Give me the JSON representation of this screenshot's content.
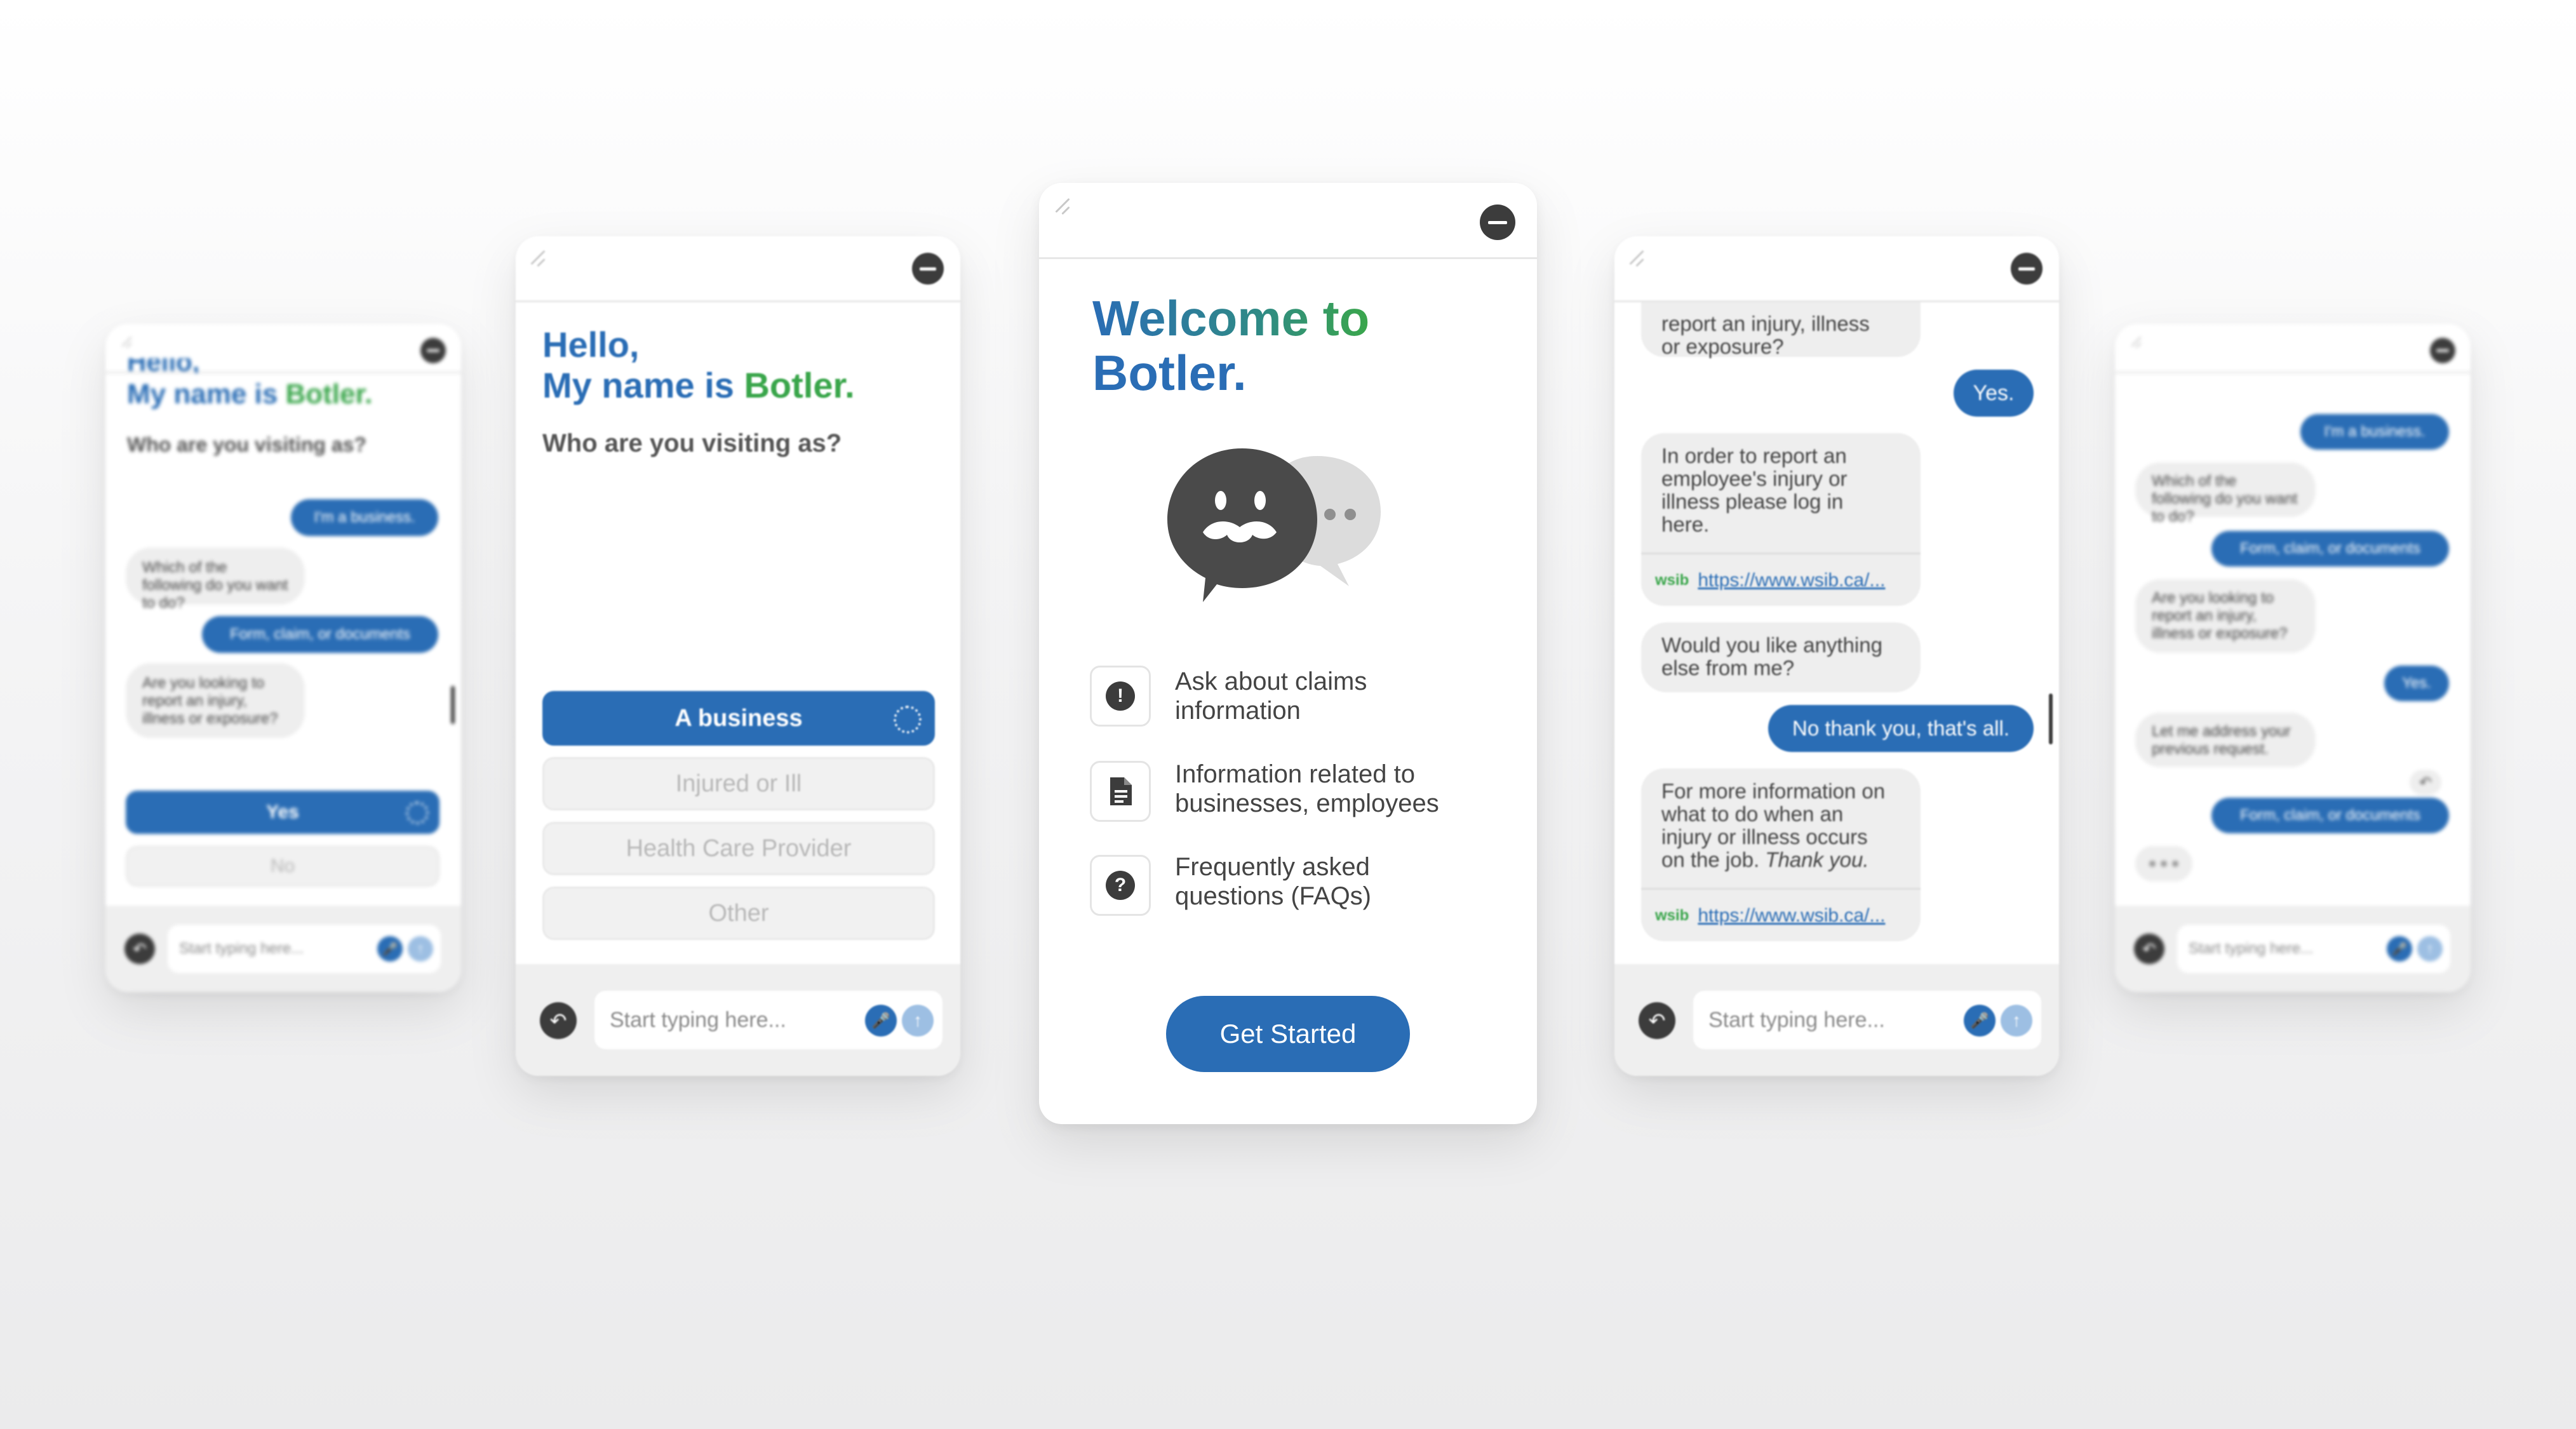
{
  "colors": {
    "primary": "#2a6db5",
    "green": "#3aa64b",
    "bubble": "#eeeeee",
    "dark": "#3c3c3c"
  },
  "common": {
    "input_placeholder": "Start typing here...",
    "link": "https://www.wsib.ca/...",
    "link_badge": "wsib"
  },
  "far_left": {
    "hello_partial": "Hello,",
    "name_prefix": "My name is ",
    "name": "Botler.",
    "question": "Who are you visiting as?",
    "messages": [
      "I'm a business.",
      "Which of the following do you want to do?",
      "Form, claim, or documents",
      "Are you looking to report an injury, illness or exposure?"
    ],
    "yes": "Yes",
    "no": "No"
  },
  "left": {
    "hello": "Hello,",
    "name_prefix": "My name is ",
    "name": "Botler.",
    "question": "Who are you visiting as?",
    "options": [
      "A business",
      "Injured or Ill",
      "Health Care Provider",
      "Other"
    ]
  },
  "center": {
    "title_line1": "Welcome to",
    "title_line2": "Botler.",
    "features": [
      {
        "icon": "exclamation-icon",
        "line1": "Ask about claims",
        "line2": "information"
      },
      {
        "icon": "document-icon",
        "line1": "Information related to",
        "line2": "businesses, employees"
      },
      {
        "icon": "question-icon",
        "line1": "Frequently asked",
        "line2": "questions (FAQs)"
      }
    ],
    "cta": "Get Started"
  },
  "right": {
    "msg0": [
      "report an injury, illness",
      "or exposure?"
    ],
    "msg1": "Yes.",
    "msg2": [
      "In order to report an",
      "employee's injury or",
      "illness please log in",
      "here."
    ],
    "msg3": [
      "Would you like anything",
      "else from me?"
    ],
    "msg4": "No thank you, that's all.",
    "msg5": [
      "For more information on",
      "what to do when an",
      "injury or illness occurs",
      "on the job."
    ],
    "msg5_italic": "Thank you."
  },
  "far_right": {
    "messages": [
      "I'm a business.",
      "Which of the following do you want to do?",
      "Form, claim, or documents",
      "Are you looking to report an injury, illness or exposure?",
      "Yes.",
      "Let me address your previous request.",
      "Form, claim, or documents"
    ]
  }
}
